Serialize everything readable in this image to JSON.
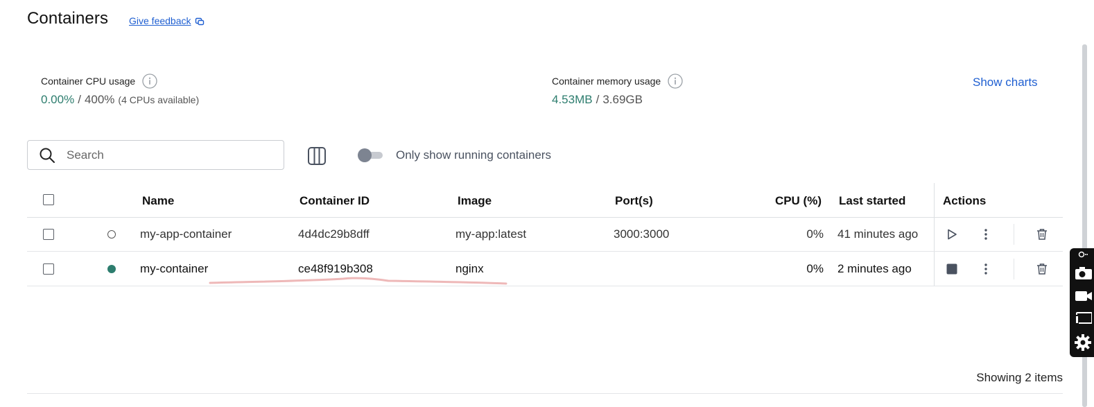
{
  "header": {
    "title": "Containers",
    "feedback_label": "Give feedback"
  },
  "stats": {
    "cpu": {
      "label": "Container CPU usage",
      "used": "0.00%",
      "sep": "/",
      "total": "400%",
      "note": "(4 CPUs available)"
    },
    "memory": {
      "label": "Container memory usage",
      "used": "4.53MB",
      "sep": "/",
      "total": "3.69GB"
    },
    "show_charts_label": "Show charts"
  },
  "toolbar": {
    "search_placeholder": "Search",
    "toggle_label": "Only show running containers",
    "toggle_on": false
  },
  "table": {
    "columns": [
      "Name",
      "Container ID",
      "Image",
      "Port(s)",
      "CPU (%)",
      "Last started",
      "Actions"
    ],
    "rows": [
      {
        "status": "stopped",
        "name": "my-app-container",
        "id": "4d4dc29b8dff",
        "image": "my-app:latest",
        "ports": "3000:3000",
        "cpu": "0%",
        "last_started": "41 minutes ago",
        "primary_action": "start"
      },
      {
        "status": "running",
        "name": "my-container",
        "id": "ce48f919b308",
        "image": "nginx",
        "ports": "",
        "cpu": "0%",
        "last_started": "2 minutes ago",
        "primary_action": "stop"
      }
    ]
  },
  "footer": {
    "items_count_label": "Showing 2 items"
  },
  "colors": {
    "accent": "#2d7d6e",
    "link": "#1f5fd1",
    "annotation": "#e8a0a0"
  },
  "icons": [
    "external-link-icon",
    "info-icon",
    "search-icon",
    "columns-icon",
    "play-icon",
    "stop-icon",
    "kebab-menu-icon",
    "trash-icon",
    "camera-icon",
    "video-icon",
    "screen-icon",
    "gear-icon"
  ]
}
